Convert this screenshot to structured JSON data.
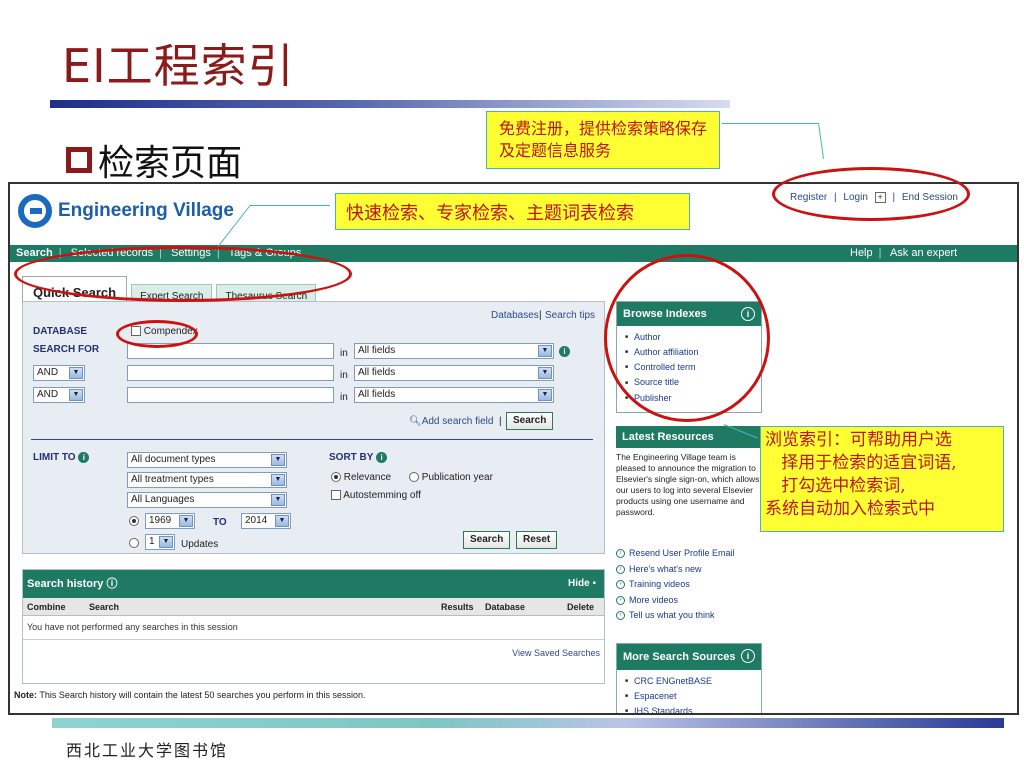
{
  "slide": {
    "title": "EI工程索引",
    "subtitle": "检索页面",
    "footer": "西北工业大学图书馆",
    "callouts": {
      "top": "免费注册，提供检索策略保存及定题信息服务",
      "mid": "快速检索、专家检索、主题词表检索",
      "right": "浏览索引：可帮助用户选\n   择用于检索的适宜词语,\n   打勾选中检索词,\n系统自动加入检索式中"
    }
  },
  "app": {
    "logo_text": "Engineering Village",
    "top_links": {
      "register": "Register",
      "login": "Login",
      "end_session": "End Session"
    },
    "nav": {
      "search": "Search",
      "selected_records": "Selected records",
      "settings": "Settings",
      "tags_groups": "Tags & Groups",
      "help": "Help",
      "ask_expert": "Ask an expert"
    },
    "tabs": {
      "quick": "Quick Search",
      "expert": "Expert Search",
      "thesaurus": "Thesaurus Search"
    },
    "panel": {
      "databases_link": "Databases",
      "search_tips_link": "Search tips",
      "database_label": "DATABASE",
      "database_value": "Compendex",
      "search_for_label": "SEARCH FOR",
      "in_label": "in",
      "all_fields": "All fields",
      "and": "AND",
      "add_search_field": "Add search field",
      "search_button": "Search",
      "limit_to_label": "LIMIT TO",
      "doc_types": "All document types",
      "treatment_types": "All treatment types",
      "languages": "All Languages",
      "year_from": "1969",
      "to_label": "TO",
      "year_to": "2014",
      "updates_value": "1",
      "updates_label": "Updates",
      "sort_by_label": "SORT BY",
      "relevance": "Relevance",
      "publication_year": "Publication year",
      "autostemming": "Autostemming off",
      "reset_button": "Reset"
    },
    "history": {
      "title": "Search history",
      "hide": "Hide",
      "columns": [
        "Combine",
        "Search",
        "Results",
        "Database",
        "Delete"
      ],
      "empty": "You have not performed any searches in this session",
      "view_saved": "View Saved Searches",
      "note_bold": "Note:",
      "note": "This Search history will contain the latest 50 searches you perform in this session."
    },
    "browse": {
      "title": "Browse Indexes",
      "items": [
        "Author",
        "Author affiliation",
        "Controlled term",
        "Source title",
        "Publisher"
      ]
    },
    "latest": {
      "title": "Latest Resources",
      "text": "The Engineering Village team is pleased to announce the migration to Elsevier's single sign-on, which allows our users to log into several Elsevier products using one username and password.",
      "links": [
        "Resend User Profile Email",
        "Here's what's new",
        "Training videos",
        "More videos",
        "Tell us what you think"
      ]
    },
    "more_sources": {
      "title": "More Search Sources",
      "items": [
        "CRC ENGnetBASE",
        "Espacenet",
        "IHS Standards"
      ]
    }
  },
  "colors": {
    "brand_green": "#1e7a62",
    "title_red": "#8b1a1a",
    "annotation_red": "#cc1111",
    "callout_yellow": "#ffff33"
  }
}
